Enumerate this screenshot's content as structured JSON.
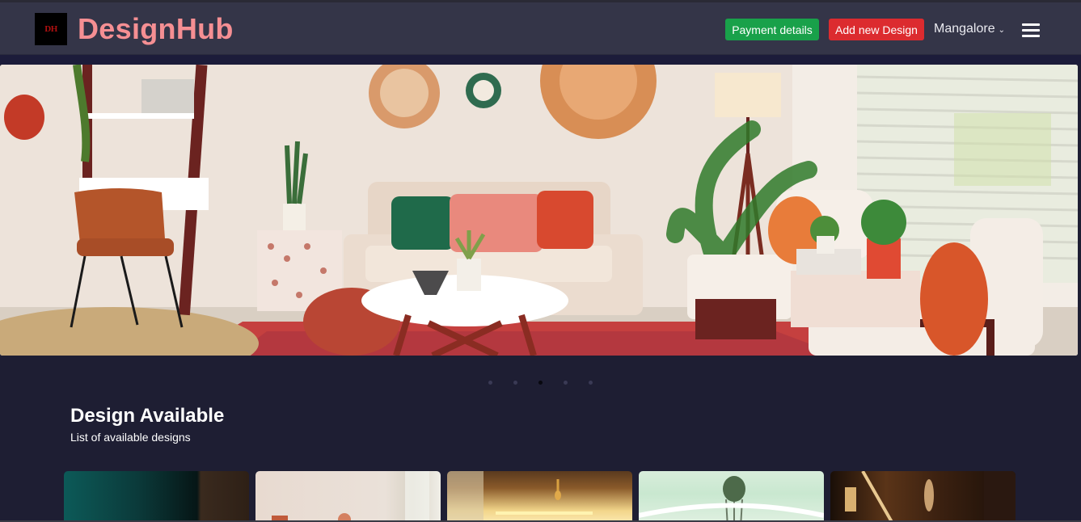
{
  "header": {
    "logo_text": "DH",
    "brand": "DesignHub",
    "payment_button": "Payment details",
    "add_design_button": "Add new Design",
    "location": "Mangalore",
    "location_chevron": "⌄",
    "menu_icon": "hamburger-icon"
  },
  "hero": {
    "image": "living-room-interior",
    "slide_count": 5,
    "active_slide": 3
  },
  "section": {
    "title": "Design Available",
    "subtitle": "List of available designs"
  },
  "cards": [
    {
      "image": "teal-wall-interior"
    },
    {
      "image": "bright-room-interior"
    },
    {
      "image": "wood-ceiling-lighting"
    },
    {
      "image": "pale-green-ceiling-chandelier"
    },
    {
      "image": "dark-wood-interior"
    }
  ],
  "colors": {
    "navbar": "#343548",
    "background": "#1e1e33",
    "brand": "#f58f93",
    "payment": "#19a14a",
    "add": "#dc2b2f"
  }
}
